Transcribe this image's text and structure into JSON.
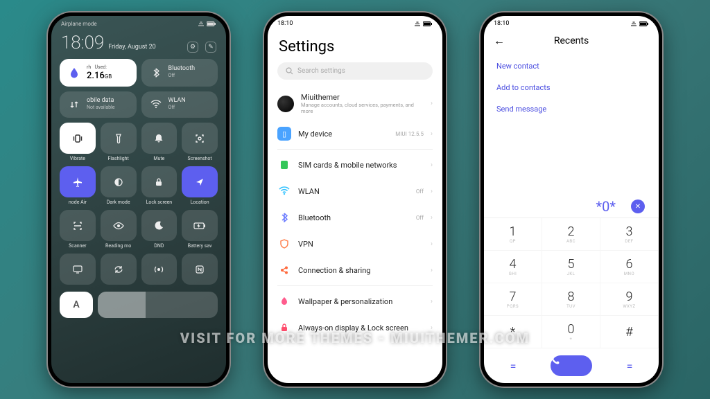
{
  "watermark": "VISIT FOR MORE THEMES - MIUITHEMER.COM",
  "phone1": {
    "status_left": "Airplane mode",
    "time": "18:09",
    "date": "Friday, August 20",
    "tiles_large": [
      {
        "value": "2.16",
        "unit": "GB",
        "sub_pre": "rh",
        "sub": "Used:"
      },
      {
        "title": "Bluetooth",
        "sub": "Off"
      },
      {
        "title": "obile data",
        "sub": "Not available"
      },
      {
        "title": "WLAN",
        "sub": "Off"
      }
    ],
    "row1": [
      {
        "label": "Vibrate"
      },
      {
        "label": "Flashlight"
      },
      {
        "label": "Mute"
      },
      {
        "label": "Screenshot"
      }
    ],
    "row2": [
      {
        "label": "node   Air"
      },
      {
        "label": "Dark mode"
      },
      {
        "label": "Lock screen"
      },
      {
        "label": "Location"
      }
    ],
    "row3": [
      {
        "label": "Scanner"
      },
      {
        "label": "Reading mo"
      },
      {
        "label": "DND"
      },
      {
        "label": "Battery sav"
      }
    ],
    "bottom_a": "A"
  },
  "phone2": {
    "status_time": "18:10",
    "title": "Settings",
    "search_placeholder": "Search settings",
    "account": {
      "title": "Miuithemer",
      "sub": "Manage accounts, cloud services, payments, and more"
    },
    "rows": [
      {
        "icon_color": "#4aa3ff",
        "title": "My device",
        "val": "MIUI 12.5.5"
      },
      {
        "icon_color": "#34c759",
        "title": "SIM cards & mobile networks",
        "val": ""
      },
      {
        "icon_color": "#35c3ff",
        "title": "WLAN",
        "val": "Off"
      },
      {
        "icon_color": "#6a7bff",
        "title": "Bluetooth",
        "val": "Off"
      },
      {
        "icon_color": "#ff7a45",
        "title": "VPN",
        "val": ""
      },
      {
        "icon_color": "#ff6a3d",
        "title": "Connection & sharing",
        "val": ""
      },
      {
        "icon_color": "#ff5c8d",
        "title": "Wallpaper & personalization",
        "val": ""
      },
      {
        "icon_color": "#ff4d6d",
        "title": "Always-on display & Lock screen",
        "val": ""
      }
    ]
  },
  "phone3": {
    "status_time": "18:10",
    "header": "Recents",
    "links": [
      "New contact",
      "Add to contacts",
      "Send message"
    ],
    "display": "*0*",
    "keys": [
      {
        "d": "1",
        "l": "QP"
      },
      {
        "d": "2",
        "l": "ABC"
      },
      {
        "d": "3",
        "l": "DEF"
      },
      {
        "d": "4",
        "l": "GHI"
      },
      {
        "d": "5",
        "l": "JKL"
      },
      {
        "d": "6",
        "l": "MNO"
      },
      {
        "d": "7",
        "l": "PQRS"
      },
      {
        "d": "8",
        "l": "TUV"
      },
      {
        "d": "9",
        "l": "WXYZ"
      },
      {
        "d": "*",
        "l": ""
      },
      {
        "d": "0",
        "l": "+"
      },
      {
        "d": "#",
        "l": ""
      }
    ],
    "bottom_sym": "="
  }
}
